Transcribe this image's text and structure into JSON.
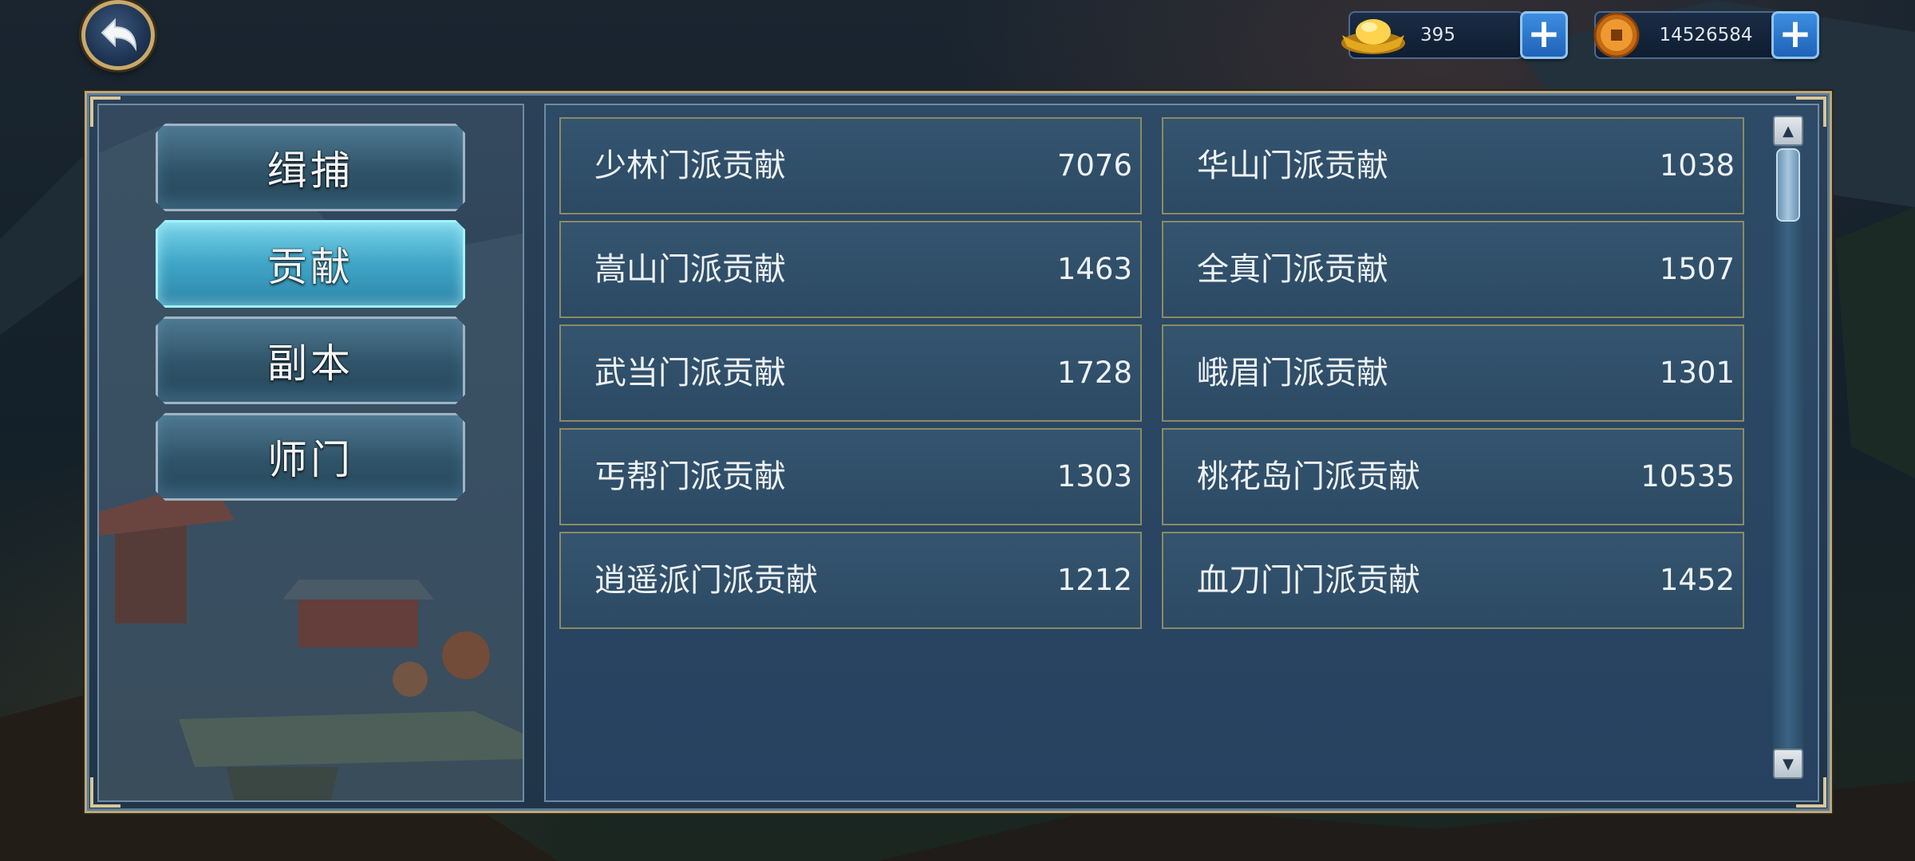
{
  "currency": {
    "gold_ingot": {
      "icon": "gold-ingot-icon",
      "value": "395"
    },
    "copper_coin": {
      "icon": "copper-coin-icon",
      "value": "14526584"
    }
  },
  "tabs": [
    {
      "label": "缉捕",
      "active": false
    },
    {
      "label": "贡献",
      "active": true
    },
    {
      "label": "副本",
      "active": false
    },
    {
      "label": "师门",
      "active": false
    }
  ],
  "contributions": [
    {
      "name": "少林门派贡献",
      "value": "7076"
    },
    {
      "name": "华山门派贡献",
      "value": "1038"
    },
    {
      "name": "嵩山门派贡献",
      "value": "1463"
    },
    {
      "name": "全真门派贡献",
      "value": "1507"
    },
    {
      "name": "武当门派贡献",
      "value": "1728"
    },
    {
      "name": "峨眉门派贡献",
      "value": "1301"
    },
    {
      "name": "丐帮门派贡献",
      "value": "1303"
    },
    {
      "name": "桃花岛门派贡献",
      "value": "10535"
    },
    {
      "name": "逍遥派门派贡献",
      "value": "1212"
    },
    {
      "name": "血刀门门派贡献",
      "value": "1452"
    }
  ],
  "colors": {
    "panel_border": "#b9a77d",
    "active_tab": "#3fa5c6",
    "plus_button": "#2a78cf"
  }
}
